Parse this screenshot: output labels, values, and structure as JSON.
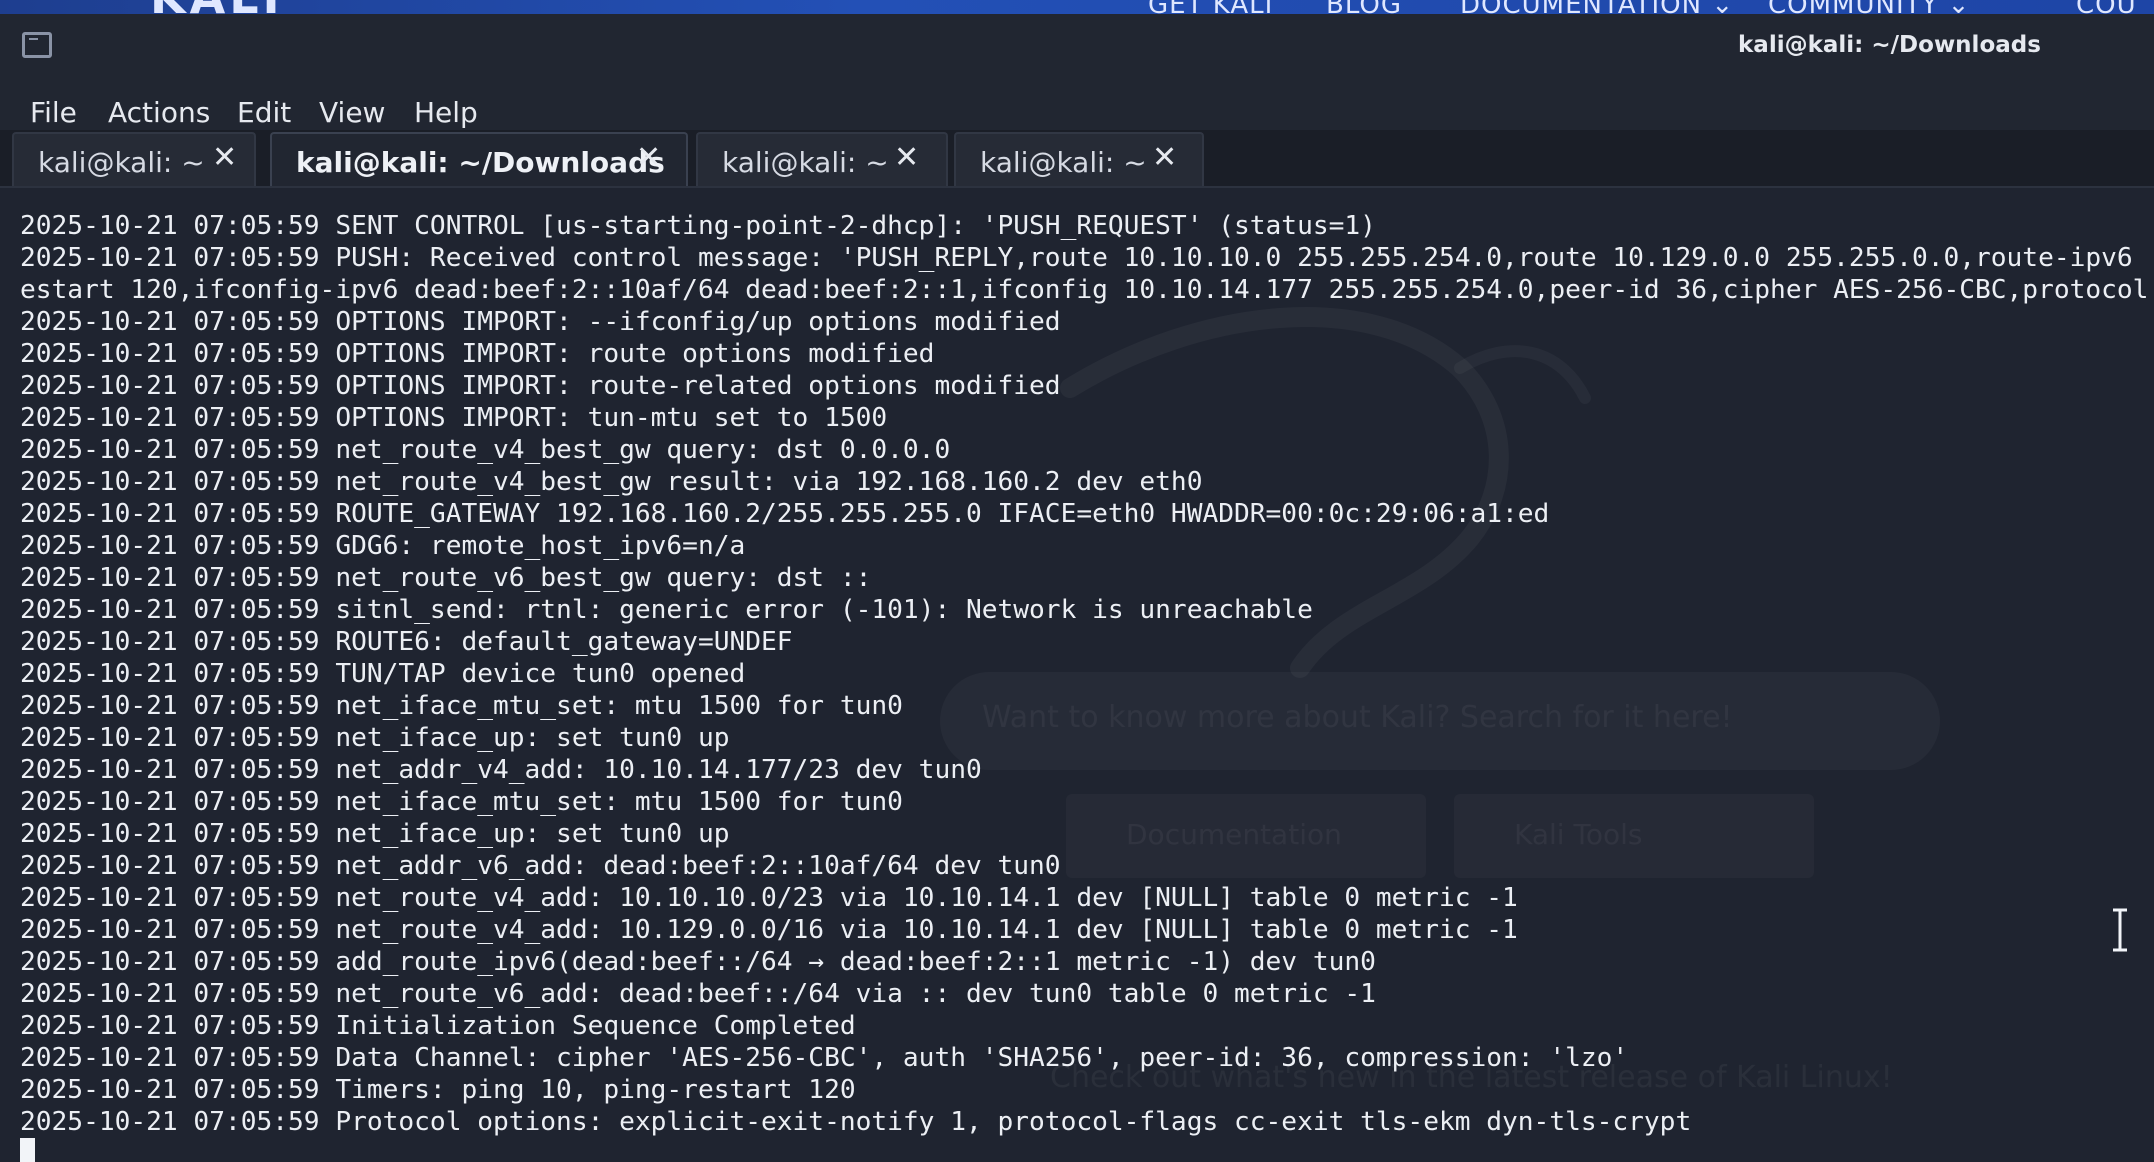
{
  "background_page": {
    "logo": "KALI",
    "nav": [
      "GET KALI",
      "BLOG",
      "DOCUMENTATION ⌄",
      "COMMUNITY ⌄",
      "COU"
    ],
    "search_placeholder": "Want to know more about Kali? Search for it here!",
    "buttons": [
      "Documentation",
      "Kali Tools"
    ],
    "news": "Check out what's new in the latest release of Kali Linux!"
  },
  "window": {
    "title": "kali@kali: ~/Downloads",
    "icon": "terminal-icon"
  },
  "menu": {
    "items": [
      "File",
      "Actions",
      "Edit",
      "View",
      "Help"
    ]
  },
  "tabs": [
    {
      "label": "kali@kali: ~",
      "close": "✕",
      "active": false
    },
    {
      "label": "kali@kali: ~/Downloads",
      "close": "✕",
      "active": true
    },
    {
      "label": "kali@kali: ~",
      "close": "✕",
      "active": false
    },
    {
      "label": "kali@kali: ~",
      "close": "✕",
      "active": false
    }
  ],
  "terminal": {
    "lines": [
      "2025-10-21 07:05:59 SENT CONTROL [us-starting-point-2-dhcp]: 'PUSH_REQUEST' (status=1)",
      "2025-10-21 07:05:59 PUSH: Received control message: 'PUSH_REPLY,route 10.10.10.0 255.255.254.0,route 10.129.0.0 255.255.0.0,route-ipv6",
      "estart 120,ifconfig-ipv6 dead:beef:2::10af/64 dead:beef:2::1,ifconfig 10.10.14.177 255.255.254.0,peer-id 36,cipher AES-256-CBC,protocol",
      "2025-10-21 07:05:59 OPTIONS IMPORT: --ifconfig/up options modified",
      "2025-10-21 07:05:59 OPTIONS IMPORT: route options modified",
      "2025-10-21 07:05:59 OPTIONS IMPORT: route-related options modified",
      "2025-10-21 07:05:59 OPTIONS IMPORT: tun-mtu set to 1500",
      "2025-10-21 07:05:59 net_route_v4_best_gw query: dst 0.0.0.0",
      "2025-10-21 07:05:59 net_route_v4_best_gw result: via 192.168.160.2 dev eth0",
      "2025-10-21 07:05:59 ROUTE_GATEWAY 192.168.160.2/255.255.255.0 IFACE=eth0 HWADDR=00:0c:29:06:a1:ed",
      "2025-10-21 07:05:59 GDG6: remote_host_ipv6=n/a",
      "2025-10-21 07:05:59 net_route_v6_best_gw query: dst ::",
      "2025-10-21 07:05:59 sitnl_send: rtnl: generic error (-101): Network is unreachable",
      "2025-10-21 07:05:59 ROUTE6: default_gateway=UNDEF",
      "2025-10-21 07:05:59 TUN/TAP device tun0 opened",
      "2025-10-21 07:05:59 net_iface_mtu_set: mtu 1500 for tun0",
      "2025-10-21 07:05:59 net_iface_up: set tun0 up",
      "2025-10-21 07:05:59 net_addr_v4_add: 10.10.14.177/23 dev tun0",
      "2025-10-21 07:05:59 net_iface_mtu_set: mtu 1500 for tun0",
      "2025-10-21 07:05:59 net_iface_up: set tun0 up",
      "2025-10-21 07:05:59 net_addr_v6_add: dead:beef:2::10af/64 dev tun0",
      "2025-10-21 07:05:59 net_route_v4_add: 10.10.10.0/23 via 10.10.14.1 dev [NULL] table 0 metric -1",
      "2025-10-21 07:05:59 net_route_v4_add: 10.129.0.0/16 via 10.10.14.1 dev [NULL] table 0 metric -1",
      "2025-10-21 07:05:59 add_route_ipv6(dead:beef::/64 → dead:beef:2::1 metric -1) dev tun0",
      "2025-10-21 07:05:59 net_route_v6_add: dead:beef::/64 via :: dev tun0 table 0 metric -1",
      "2025-10-21 07:05:59 Initialization Sequence Completed",
      "2025-10-21 07:05:59 Data Channel: cipher 'AES-256-CBC', auth 'SHA256', peer-id: 36, compression: 'lzo'",
      "2025-10-21 07:05:59 Timers: ping 10, ping-restart 120",
      "2025-10-21 07:05:59 Protocol options: explicit-exit-notify 1, protocol-flags cc-exit tls-ekm dyn-tls-crypt"
    ]
  },
  "colors": {
    "terminal_bg": "#1f2430",
    "terminal_fg": "#eceff4",
    "chrome_bg": "#212631",
    "site_bar": "#2350b6"
  }
}
